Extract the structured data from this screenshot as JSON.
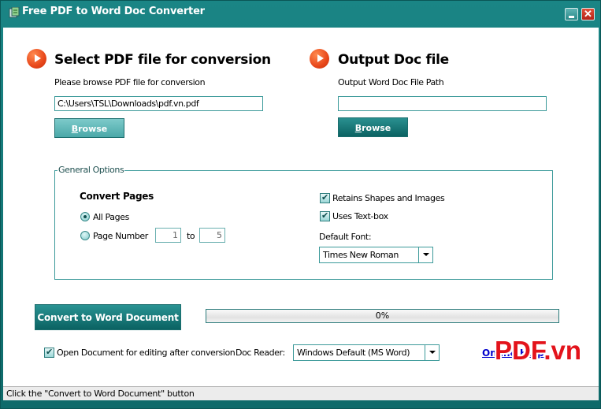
{
  "window": {
    "title": "Free PDF to Word Doc Converter",
    "icon": "app-icon",
    "minimize_icon": "minimize-icon",
    "close_glyph": "✕"
  },
  "input_section": {
    "icon": "play-arrow-icon",
    "title": "Select PDF file for conversion",
    "label": "Please browse PDF file for conversion",
    "path_value": "C:\\Users\\TSL\\Downloads\\pdf.vn.pdf",
    "browse_label_first": "B",
    "browse_label_rest": "rowse"
  },
  "output_section": {
    "icon": "play-arrow-icon",
    "title": "Output Doc file",
    "label": "Output Word Doc File Path",
    "path_value": "",
    "browse_label_first": "B",
    "browse_label_rest": "rowse"
  },
  "options": {
    "legend": "General Options",
    "convert_pages_title": "Convert Pages",
    "all_pages_label": "All Pages",
    "all_pages_checked": true,
    "page_number_label": "Page Number",
    "page_number_checked": false,
    "page_from": "1",
    "to_label": "to",
    "page_to": "5",
    "retain_shapes_label": "Retains Shapes and Images",
    "retain_shapes_checked": true,
    "uses_textbox_label": "Uses Text-box",
    "uses_textbox_checked": true,
    "default_font_label": "Default Font:",
    "default_font_value": "Times New Roman"
  },
  "actions": {
    "convert_label": "Convert to Word Document",
    "progress_percent": 0,
    "progress_text": "0%",
    "open_doc_label": "Open Document for editing after conversion",
    "open_doc_checked": true,
    "doc_reader_label": "Doc Reader:",
    "doc_reader_value": "Windows Default (MS Word)",
    "online_help_label": "Online Help"
  },
  "watermark": "PDF.vn",
  "status": {
    "text": "Click the \"Convert to Word Document\" button"
  },
  "colors": {
    "frame": "#0f6b6b",
    "accent": "#2a9393",
    "arrow": "#e8471a",
    "link": "#0000cc",
    "watermark": "#e3131b"
  }
}
